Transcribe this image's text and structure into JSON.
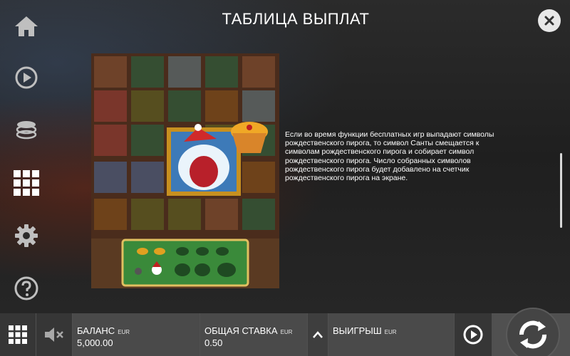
{
  "paytable": {
    "title": "ТАБЛИЦА ВЫПЛАТ",
    "description": "Если во время функции бесплатных игр выпадают символы рождественского пирога, то символ Санты смещается к символам рождественского пирога и собирает символ рождественского пирога. Число собранных символов рождественского пирога будет добавлено на счетчик рождественского пирога на экране."
  },
  "sidenav": {
    "items": [
      {
        "icon": "home-icon"
      },
      {
        "icon": "autoplay-icon"
      },
      {
        "icon": "coins-icon"
      },
      {
        "icon": "paytable-grid-icon"
      },
      {
        "icon": "gear-icon"
      },
      {
        "icon": "help-icon"
      }
    ]
  },
  "bottombar": {
    "balance_label": "БАЛАНС",
    "balance_currency": "EUR",
    "balance_value": "5,000.00",
    "bet_label": "ОБЩАЯ СТАВКА",
    "bet_currency": "EUR",
    "bet_value": "0.50",
    "win_label": "ВЫИГРЫШ",
    "win_currency": "EUR"
  },
  "colors": {
    "accent_gold": "#d9a23a",
    "panel": "#4a4a4a",
    "button": "#363636"
  }
}
